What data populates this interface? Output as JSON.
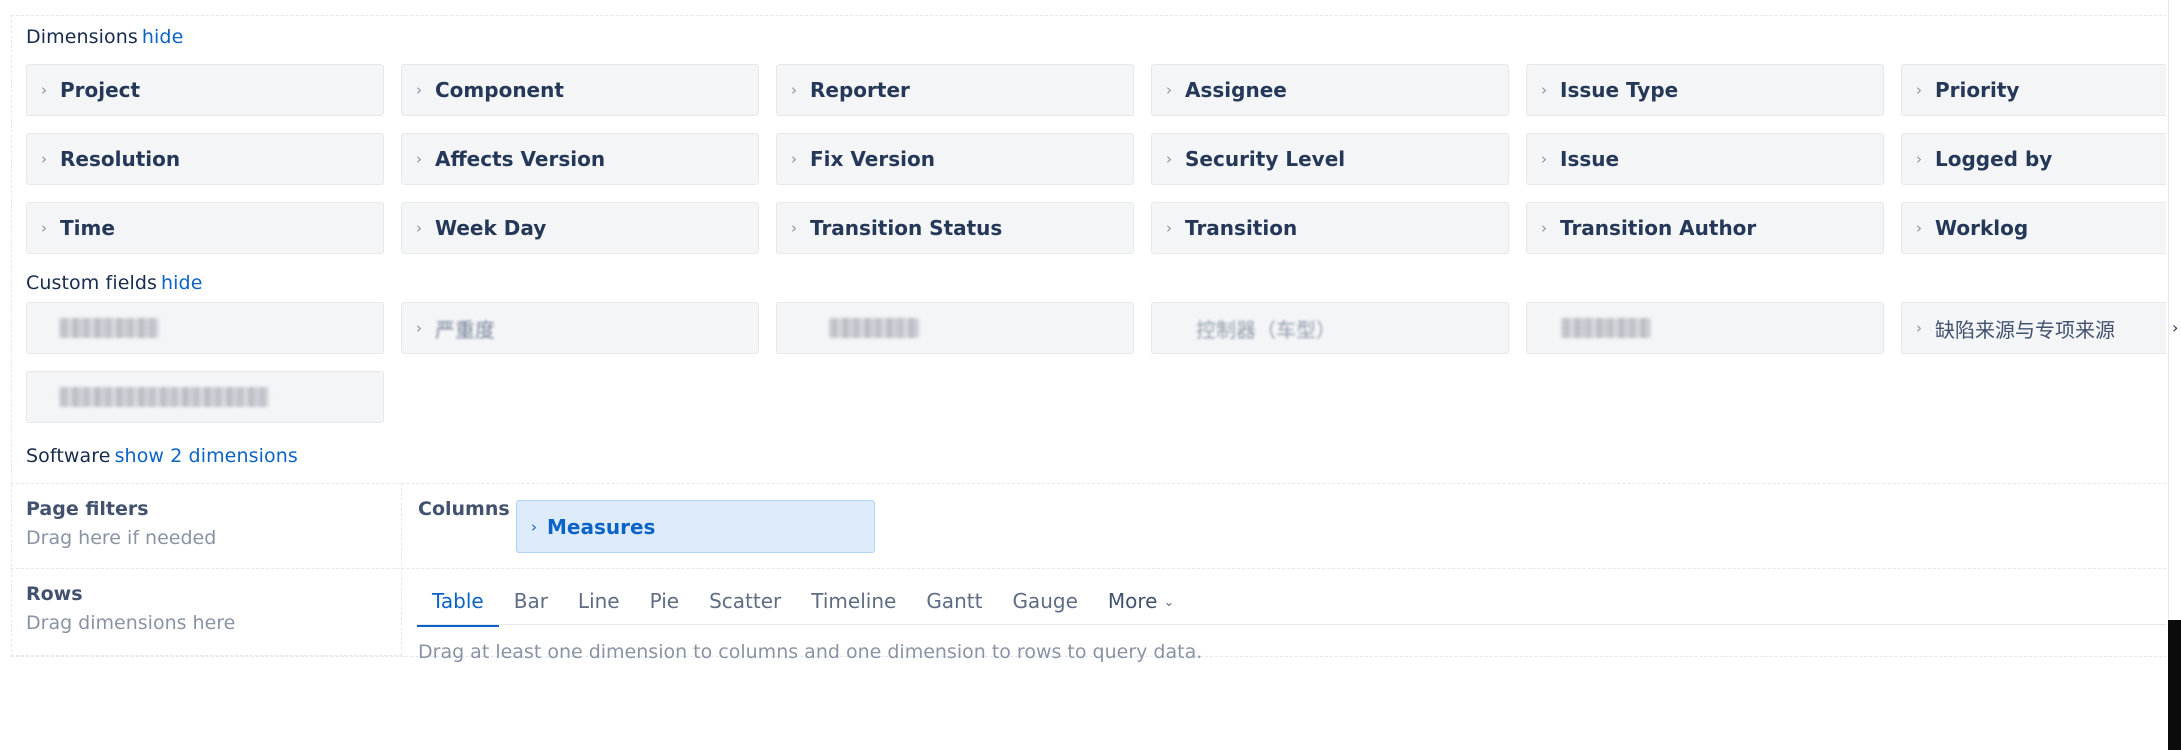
{
  "dimensions": {
    "title": "Dimensions",
    "toggle": "hide",
    "items": [
      "Project",
      "Component",
      "Reporter",
      "Assignee",
      "Issue Type",
      "Priority",
      "Resolution",
      "Affects Version",
      "Fix Version",
      "Security Level",
      "Issue",
      "Logged by",
      "Time",
      "Week Day",
      "Transition Status",
      "Transition",
      "Transition Author",
      "Worklog"
    ]
  },
  "custom_fields": {
    "title": "Custom fields",
    "toggle": "hide",
    "items": [
      {
        "label": ""
      },
      {
        "label": "严重度"
      },
      {
        "label": ""
      },
      {
        "label": "控制器（车型）"
      },
      {
        "label": ""
      },
      {
        "label": "缺陷来源与专项来源"
      },
      {
        "label": ""
      }
    ]
  },
  "software": {
    "title": "Software",
    "toggle": "show 2 dimensions"
  },
  "page_filters": {
    "title": "Page filters",
    "hint": "Drag here if needed"
  },
  "rows": {
    "title": "Rows",
    "hint": "Drag dimensions here"
  },
  "columns": {
    "title": "Columns",
    "chip": "Measures"
  },
  "chart_tabs": {
    "items": [
      "Table",
      "Bar",
      "Line",
      "Pie",
      "Scatter",
      "Timeline",
      "Gantt",
      "Gauge",
      "More"
    ],
    "active": "Table"
  },
  "query_hint": "Drag at least one dimension to columns and one dimension to rows to query data."
}
